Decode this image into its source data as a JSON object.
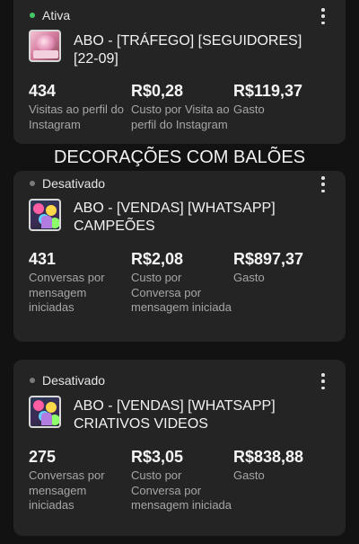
{
  "cards": [
    {
      "status": "Ativa",
      "title": "ABO - [TRÁFEGO] [SEGUIDORES] [22-09]",
      "metrics": [
        {
          "value": "434",
          "label": "Visitas ao perfil do Instagram"
        },
        {
          "value": "R$0,28",
          "label": "Custo por Visita ao perfil do Instagram"
        },
        {
          "value": "R$119,37",
          "label": "Gasto"
        }
      ]
    },
    {
      "status": "Desativado",
      "title": "ABO - [VENDAS] [WHATSAPP] CAMPEÕES",
      "metrics": [
        {
          "value": "431",
          "label": "Conversas por mensagem iniciadas"
        },
        {
          "value": "R$2,08",
          "label": "Custo por Conversa por mensagem iniciada"
        },
        {
          "value": "R$897,37",
          "label": "Gasto"
        }
      ]
    },
    {
      "status": "Desativado",
      "title": "ABO - [VENDAS] [WHATSAPP] CRIATIVOS VIDEOS",
      "metrics": [
        {
          "value": "275",
          "label": "Conversas por mensagem iniciadas"
        },
        {
          "value": "R$3,05",
          "label": "Custo por Conversa por mensagem iniciada"
        },
        {
          "value": "R$838,88",
          "label": "Gasto"
        }
      ]
    }
  ],
  "section_title": "DECORAÇÕES COM BALÕES",
  "colors": {
    "active_dot": "#44c767",
    "inactive_dot": "#7a7a7a",
    "card_bg": "#242424",
    "page_bg": "#121212"
  }
}
